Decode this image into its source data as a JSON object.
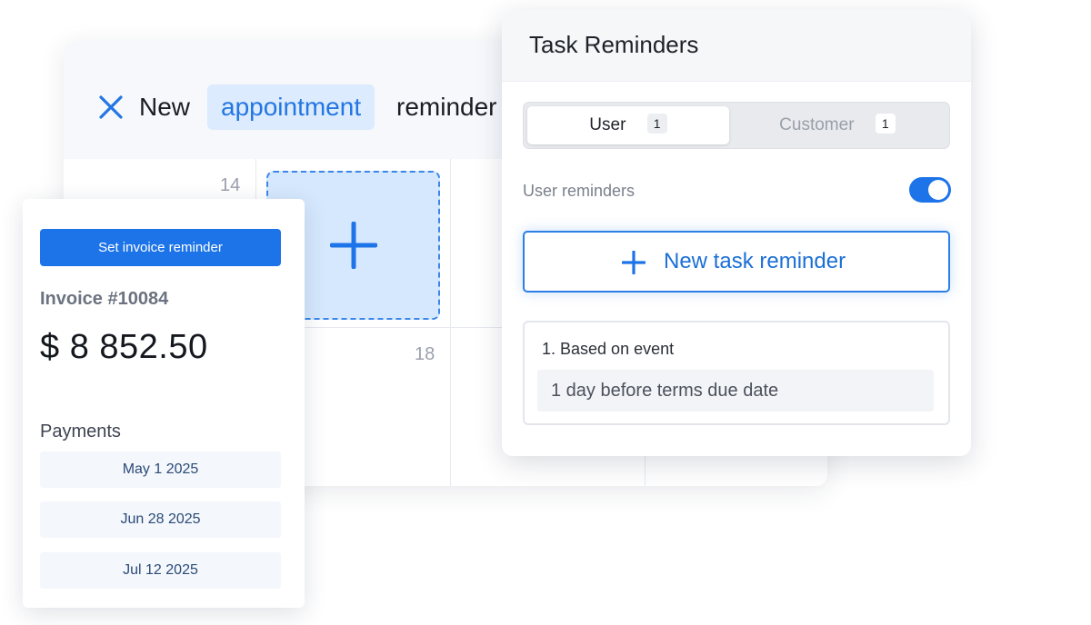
{
  "calendar": {
    "close_icon": "close-icon",
    "header_words": [
      "New",
      "appointment",
      "reminder"
    ],
    "day_numbers": [
      "14",
      "18"
    ],
    "add_icon": "plus-icon"
  },
  "invoice": {
    "button_label": "Set invoice reminder",
    "number": "Invoice #10084",
    "amount": "$ 8 852.50",
    "payments_title": "Payments",
    "payments": [
      "May 1 2025",
      "Jun 28 2025",
      "Jul 12 2025"
    ]
  },
  "task_reminders": {
    "title": "Task Reminders",
    "tabs": [
      {
        "label": "User",
        "count": "1",
        "selected": true
      },
      {
        "label": "Customer",
        "count": "1",
        "selected": false
      }
    ],
    "toggle_label": "User reminders",
    "toggle_on": true,
    "new_button_label": "New task reminder",
    "rule": {
      "title": "1. Based on event",
      "value": "1 day before terms due date"
    }
  },
  "colors": {
    "accent": "#1d74e8",
    "chip_bg": "#dcebfd",
    "drop_zone_bg": "#d6e8fd"
  }
}
